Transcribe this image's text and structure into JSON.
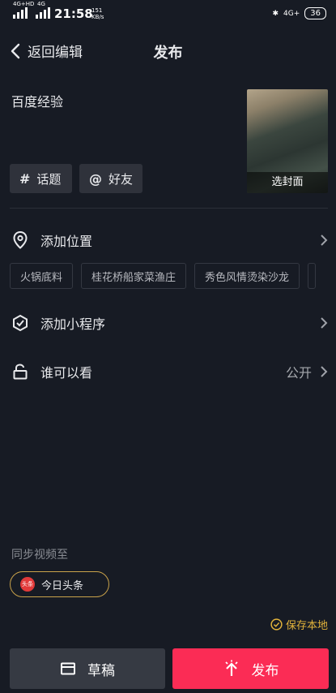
{
  "status_bar": {
    "network_left": "4G+HD",
    "network_mid": "4G",
    "time": "21:58",
    "speed_value": "151",
    "speed_unit": "KB/s",
    "network_right": "4G+",
    "battery": "36"
  },
  "header": {
    "back_label": "返回编辑",
    "title": "发布"
  },
  "post": {
    "description": "百度经验",
    "cover_label": "选封面"
  },
  "chips": {
    "topic_symbol": "#",
    "topic_label": "话题",
    "friend_symbol": "@",
    "friend_label": "好友"
  },
  "location": {
    "label": "添加位置",
    "suggestions": [
      "火锅底料",
      "桂花桥船家菜渔庄",
      "秀色风情烫染沙龙"
    ]
  },
  "mini_program": {
    "label": "添加小程序"
  },
  "visibility": {
    "label": "谁可以看",
    "value": "公开"
  },
  "sync": {
    "label": "同步视频至",
    "target_logo_text": "头条",
    "target_label": "今日头条"
  },
  "save_local": {
    "label": "保存本地",
    "checked": true
  },
  "footer": {
    "draft_label": "草稿",
    "publish_label": "发布"
  },
  "colors": {
    "background": "#171b24",
    "publish": "#fb2c55",
    "accent_gold": "#e2b33b"
  }
}
